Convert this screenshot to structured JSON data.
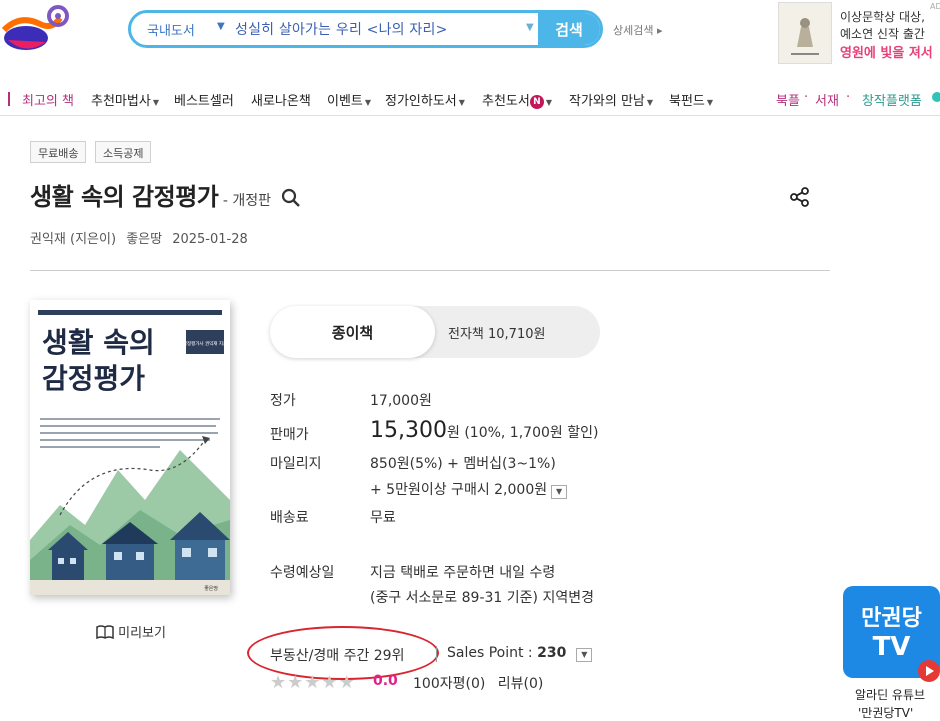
{
  "header": {
    "search": {
      "category": "국내도서",
      "query": "성실히 살아가는 우리 <나의 자리>",
      "button": "검색"
    },
    "advanced_search": "상세검색",
    "ad": {
      "line1": "이상문학상 대상,",
      "line2": "예소연 신작 출간",
      "line3": "영원에 빛을 져서",
      "mark": "AD"
    }
  },
  "nav": {
    "items": [
      "최고의 책",
      "추천마법사",
      "베스트셀러",
      "새로나온책",
      "이벤트",
      "정가인하도서",
      "추천도서",
      "작가와의 만남",
      "북펀드"
    ],
    "badge": "N",
    "right": [
      "북플",
      "서재",
      "창작플랫폼"
    ]
  },
  "product": {
    "tags": [
      "무료배송",
      "소득공제"
    ],
    "title": "생활 속의 감정평가",
    "edition": "- 개정판",
    "author": "권익재 (지은이)",
    "publisher": "좋은땅",
    "date": "2025-01-28",
    "cover": {
      "title_line1": "생활 속의",
      "title_line2": "감정평가",
      "badge": "감정평가사 권익재 지음",
      "publisher_mark": "좋은땅"
    },
    "preview": "미리보기",
    "format": {
      "paper": "종이책",
      "ebook": "전자책 10,710원"
    },
    "prices": {
      "list_label": "정가",
      "list_value": "17,000원",
      "sale_label": "판매가",
      "sale_number": "15,300",
      "sale_unit": "원",
      "sale_discount": "(10%, 1,700원 할인)",
      "mileage_label": "마일리지",
      "mileage_value": "850원(5%) + 멤버십(3~1%)",
      "mileage_extra": "+ 5만원이상 구매시 2,000원",
      "shipping_label": "배송료",
      "shipping_value": "무료",
      "delivery_label": "수령예상일",
      "delivery_value": "지금 택배로 주문하면 내일 수령",
      "delivery_location": "(중구 서소문로 89-31 기준) 지역변경"
    },
    "rank": "부동산/경매 주간 29위",
    "sales_point_label": "Sales Point : ",
    "sales_point_value": "230",
    "rating": "0.0",
    "review_count": "100자평(0)",
    "review_label": "리뷰(0)"
  },
  "tv_widget": {
    "line1": "만권당",
    "line2": "TV",
    "caption1": "알라딘 유튜브",
    "caption2": "'만권당TV'"
  },
  "colors": {
    "search_accent": "#4db6e8",
    "nav_accent": "#b4307b",
    "highlight_oval": "#d9262e",
    "tv_blue": "#1e88e5"
  }
}
